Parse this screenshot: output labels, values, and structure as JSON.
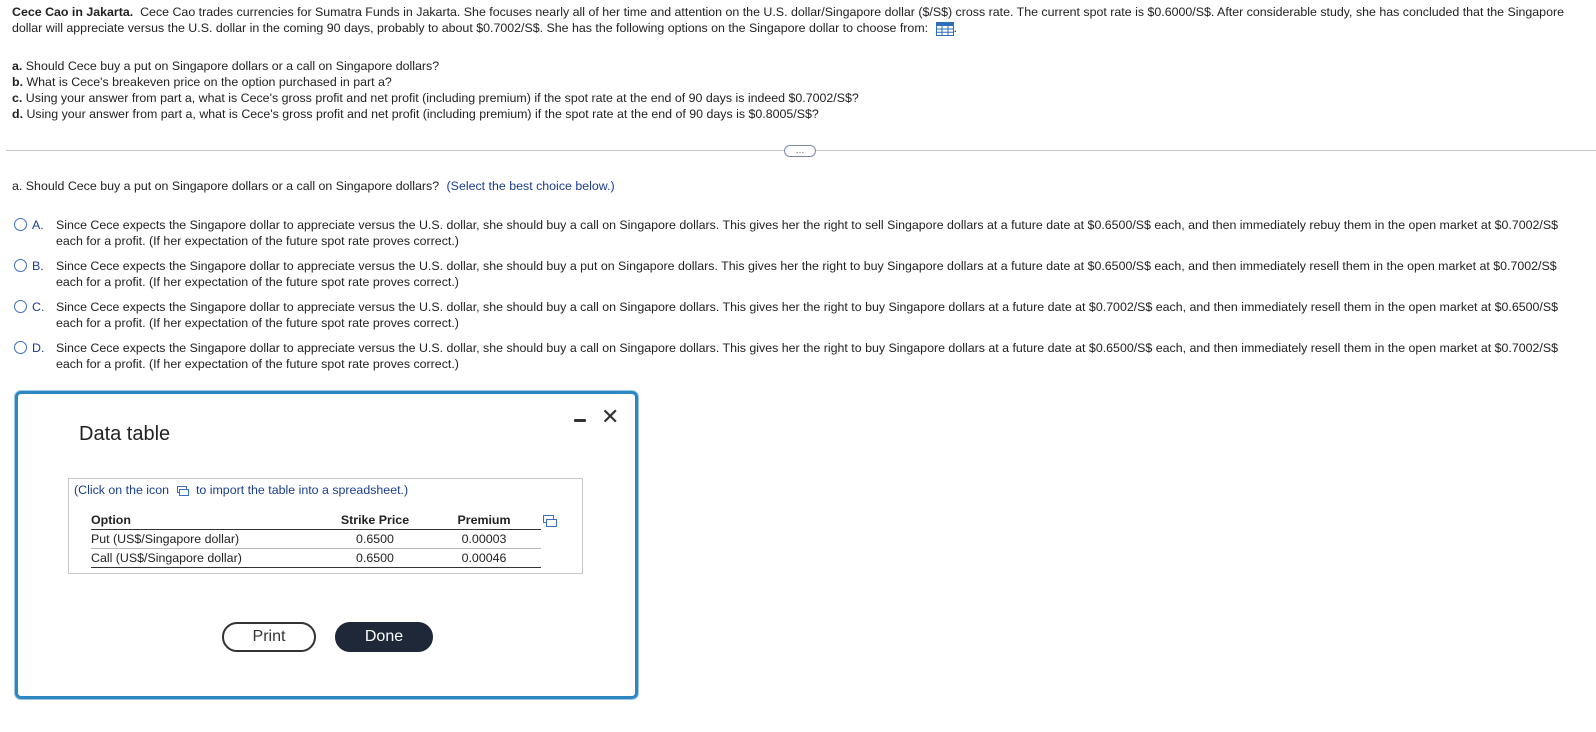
{
  "problem": {
    "title": "Cece Cao in Jakarta.",
    "text": "Cece Cao trades currencies for Sumatra Funds in Jakarta. She focuses nearly all of her time and attention on the U.S. dollar/Singapore dollar ($/S$) cross rate. The current spot rate is $0.6000/S$. After considerable study, she has concluded that the Singapore dollar will appreciate versus the U.S. dollar in the coming 90 days, probably to about $0.7002/S$. She has the following options on the Singapore dollar to choose from:",
    "icon": "table-grid-icon"
  },
  "parts": [
    {
      "letter": "a.",
      "text": "Should Cece buy a put on Singapore dollars or a call on Singapore dollars?"
    },
    {
      "letter": "b.",
      "text": "What is Cece's breakeven price on the option purchased in part a?"
    },
    {
      "letter": "c.",
      "text": "Using your answer from part a, what is Cece's gross profit and net profit (including premium) if the spot rate at the end of 90 days is indeed $0.7002/S$?"
    },
    {
      "letter": "d.",
      "text": "Using your answer from part a, what is Cece's gross profit and net profit (including premium) if the spot rate at the end of 90 days is $0.8005/S$?"
    }
  ],
  "more_label": "…",
  "question": {
    "letter": "a.",
    "text": "Should Cece buy a put on Singapore dollars or a call on Singapore dollars?",
    "hint": "(Select the best choice below.)"
  },
  "choices": [
    {
      "letter": "A.",
      "text": "Since Cece expects the Singapore dollar to appreciate versus the U.S. dollar, she should buy a call on Singapore dollars. This gives her the right to sell Singapore dollars at a future date at $0.6500/S$ each, and then immediately rebuy them in the open market at $0.7002/S$ each for a profit. (If her expectation of the future spot rate proves correct.)"
    },
    {
      "letter": "B.",
      "text": "Since Cece expects the Singapore dollar to appreciate versus the U.S. dollar, she should buy a put on Singapore dollars. This gives her the right to buy Singapore dollars at a future date at $0.6500/S$ each, and then immediately resell them in the open market at $0.7002/S$ each for a profit. (If her expectation of the future spot rate proves correct.)"
    },
    {
      "letter": "C.",
      "text": "Since Cece expects the Singapore dollar to appreciate versus the U.S. dollar, she should buy a call on Singapore dollars. This gives her the right to buy Singapore dollars at a future date at $0.7002/S$ each, and then immediately resell them in the open market at $0.6500/S$ each for a profit. (If her expectation of the future spot rate proves correct.)"
    },
    {
      "letter": "D.",
      "text": "Since Cece expects the Singapore dollar to appreciate versus the U.S. dollar, she should buy a call on Singapore dollars. This gives her the right to buy Singapore dollars at a future date at $0.6500/S$ each, and then immediately resell them in the open market at $0.7002/S$ each for a profit. (If her expectation of the future spot rate proves correct.)"
    }
  ],
  "modal": {
    "title": "Data table",
    "minimize_icon": "minimize-icon",
    "close_icon": "close-icon",
    "close_glyph": "✕",
    "import_hint_before": "(Click on the icon",
    "import_hint_after": "to import the table into a spreadsheet.)",
    "table": {
      "headers": [
        "Option",
        "Strike Price",
        "Premium"
      ],
      "rows": [
        [
          "Put (US$/Singapore dollar)",
          "0.6500",
          "0.00003"
        ],
        [
          "Call (US$/Singapore dollar)",
          "0.6500",
          "0.00046"
        ]
      ]
    },
    "print_label": "Print",
    "done_label": "Done"
  },
  "colors": {
    "accent": "#2e86c1",
    "link": "#1a3d8f",
    "done_bg": "#1e2838"
  }
}
